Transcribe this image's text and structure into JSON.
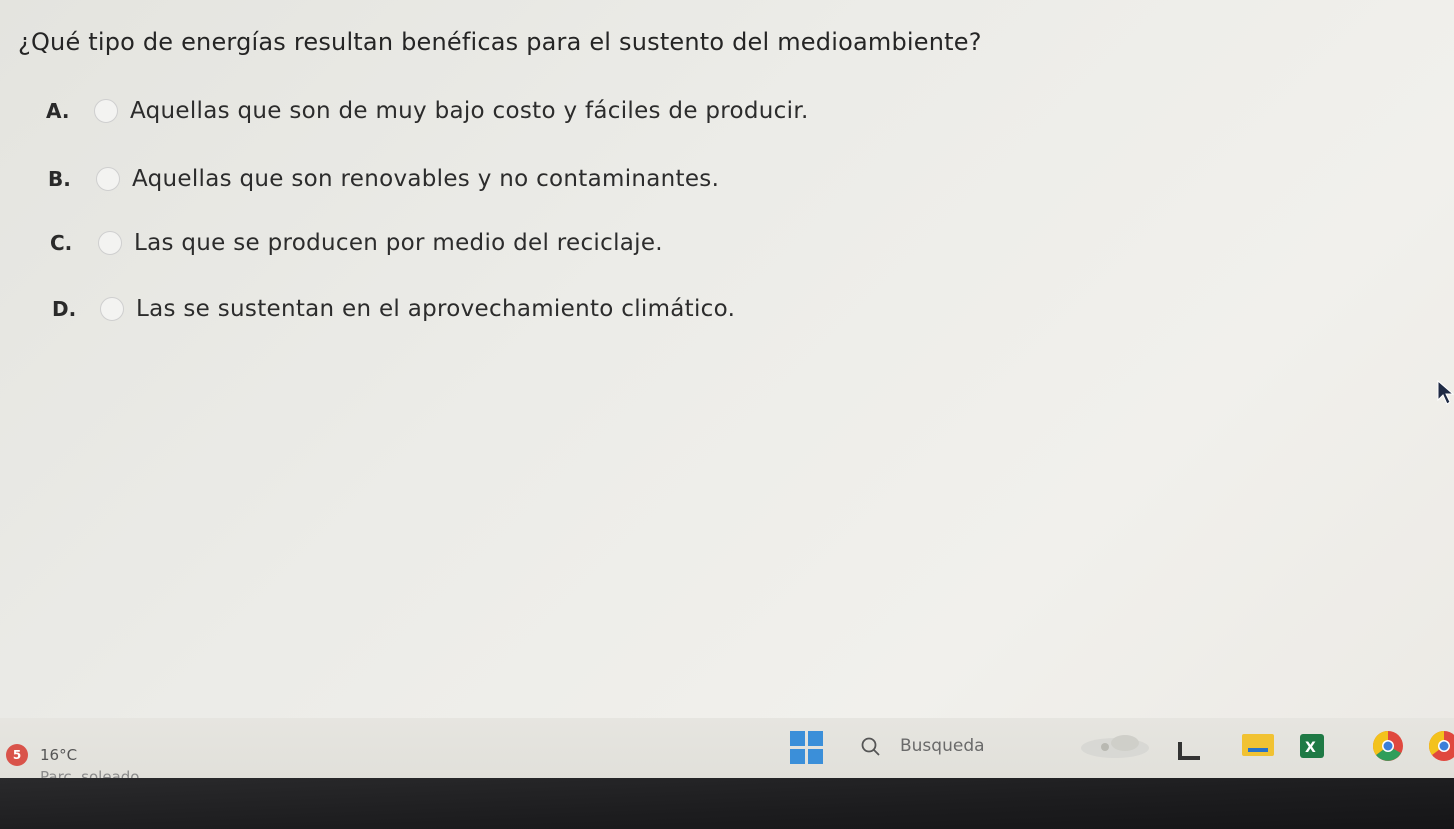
{
  "question": "¿Qué tipo de energías resultan benéficas para el sustento del medioambiente?",
  "options": [
    {
      "letter": "A.",
      "text": "Aquellas que son de muy bajo costo y fáciles de producir."
    },
    {
      "letter": "B.",
      "text": "Aquellas que son renovables y no contaminantes."
    },
    {
      "letter": "C.",
      "text": "Las que se producen por medio del reciclaje."
    },
    {
      "letter": "D.",
      "text": "Las se sustentan en el aprovechamiento climático."
    }
  ],
  "taskbar": {
    "weather_badge": "5",
    "temperature": "16°C",
    "weather_desc": "Parc. soleado",
    "search_label": "Busqueda",
    "icons": [
      "weather-widget-icon",
      "file-explorer-icon",
      "folder-icon",
      "excel-icon",
      "chrome-icon",
      "chrome-icon"
    ]
  },
  "colors": {
    "accent": "#3b8fd9",
    "badge": "#d9534a",
    "background": "#ecece8"
  }
}
